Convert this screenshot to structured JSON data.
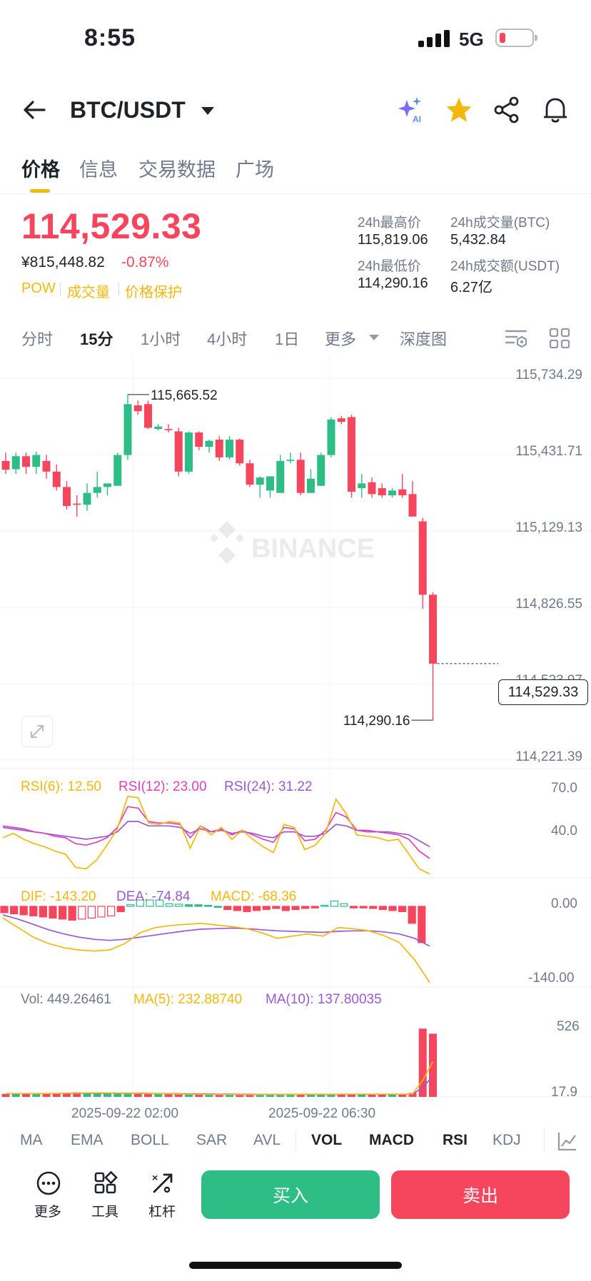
{
  "status_bar": {
    "time": "8:55",
    "network": "5G"
  },
  "header": {
    "pair": "BTC/USDT",
    "icons": [
      "back-arrow-icon",
      "dropdown-caret-icon",
      "ai-sparkle-icon",
      "star-icon",
      "share-icon",
      "bell-icon"
    ]
  },
  "tabs": [
    {
      "label": "价格",
      "active": true
    },
    {
      "label": "信息"
    },
    {
      "label": "交易数据"
    },
    {
      "label": "广场"
    }
  ],
  "ticker": {
    "last_price": "114,529.33",
    "cny_price": "¥815,448.82",
    "change_pct": "-0.87%",
    "tags": [
      "POW",
      "成交量",
      "价格保护"
    ],
    "stats": {
      "high_label": "24h最高价",
      "high": "115,819.06",
      "vol_btc_label": "24h成交量(BTC)",
      "vol_btc": "5,432.84",
      "low_label": "24h最低价",
      "low": "114,290.16",
      "vol_usdt_label": "24h成交额(USDT)",
      "vol_usdt": "6.27亿"
    }
  },
  "timeframes": [
    {
      "label": "分时"
    },
    {
      "label": "15分",
      "active": true
    },
    {
      "label": "1小时"
    },
    {
      "label": "4小时"
    },
    {
      "label": "1日"
    },
    {
      "label": "更多"
    },
    {
      "label": "深度图"
    }
  ],
  "chart": {
    "watermark": "BINANCE",
    "price_axis": [
      "115,734.29",
      "115,431.71",
      "115,129.13",
      "114,826.55",
      "114,523.97",
      "114,221.39"
    ],
    "current_price_tag": "114,529.33",
    "high_marker": "115,665.52",
    "low_marker": "114,290.16",
    "time_axis": [
      "2025-09-22 02:00",
      "2025-09-22 06:30"
    ]
  },
  "rsi": {
    "rsi6": "RSI(6): 12.50",
    "rsi12": "RSI(12): 23.00",
    "rsi24": "RSI(24): 31.22",
    "axis_top": "70.0",
    "axis_mid": "40.0"
  },
  "macd": {
    "dif": "DIF: -143.20",
    "dea": "DEA: -74.84",
    "macd": "MACD: -68.36",
    "axis_top": "0.00",
    "axis_bottom": "-140.00"
  },
  "volume": {
    "vol": "Vol: 449.26461",
    "ma5": "MA(5): 232.88740",
    "ma10": "MA(10): 137.80035",
    "axis_top": "526",
    "axis_bottom": "17.9"
  },
  "indicator_tabs": [
    {
      "label": "MA"
    },
    {
      "label": "EMA"
    },
    {
      "label": "BOLL"
    },
    {
      "label": "SAR"
    },
    {
      "label": "AVL"
    },
    {
      "label": "VOL",
      "active": true
    },
    {
      "label": "MACD",
      "active": true
    },
    {
      "label": "RSI",
      "active": true
    },
    {
      "label": "KDJ"
    }
  ],
  "toolbar": {
    "more": "更多",
    "tools": "工具",
    "leverage": "杠杆",
    "buy": "买入",
    "sell": "卖出"
  },
  "colors": {
    "up": "#2ebd85",
    "down": "#f6465d",
    "accent": "#f0b90b",
    "purple": "#9b59d0",
    "pink": "#e040c0"
  },
  "chart_data": {
    "type": "candlestick",
    "interval": "15分",
    "candles": [
      {
        "o": 115385,
        "h": 115420,
        "l": 115330,
        "c": 115348
      },
      {
        "o": 115350,
        "h": 115420,
        "l": 115330,
        "c": 115405
      },
      {
        "o": 115405,
        "h": 115420,
        "l": 115330,
        "c": 115360
      },
      {
        "o": 115360,
        "h": 115425,
        "l": 115330,
        "c": 115410
      },
      {
        "o": 115385,
        "h": 115410,
        "l": 115310,
        "c": 115340
      },
      {
        "o": 115340,
        "h": 115370,
        "l": 115260,
        "c": 115275
      },
      {
        "o": 115275,
        "h": 115300,
        "l": 115180,
        "c": 115195
      },
      {
        "o": 115205,
        "h": 115240,
        "l": 115150,
        "c": 115200
      },
      {
        "o": 115200,
        "h": 115290,
        "l": 115175,
        "c": 115250
      },
      {
        "o": 115250,
        "h": 115340,
        "l": 115230,
        "c": 115275
      },
      {
        "o": 115275,
        "h": 115290,
        "l": 115240,
        "c": 115290
      },
      {
        "o": 115280,
        "h": 115420,
        "l": 115280,
        "c": 115410
      },
      {
        "o": 115410,
        "h": 115665,
        "l": 115390,
        "c": 115625
      },
      {
        "o": 115620,
        "h": 115640,
        "l": 115580,
        "c": 115595
      },
      {
        "o": 115625,
        "h": 115640,
        "l": 115520,
        "c": 115525
      },
      {
        "o": 115520,
        "h": 115540,
        "l": 115515,
        "c": 115530
      },
      {
        "o": 115520,
        "h": 115540,
        "l": 115505,
        "c": 115515
      },
      {
        "o": 115510,
        "h": 115525,
        "l": 115320,
        "c": 115340
      },
      {
        "o": 115340,
        "h": 115510,
        "l": 115330,
        "c": 115505
      },
      {
        "o": 115505,
        "h": 115510,
        "l": 115430,
        "c": 115445
      },
      {
        "o": 115445,
        "h": 115475,
        "l": 115420,
        "c": 115470
      },
      {
        "o": 115475,
        "h": 115490,
        "l": 115385,
        "c": 115400
      },
      {
        "o": 115400,
        "h": 115490,
        "l": 115390,
        "c": 115475
      },
      {
        "o": 115475,
        "h": 115480,
        "l": 115365,
        "c": 115375
      },
      {
        "o": 115375,
        "h": 115390,
        "l": 115275,
        "c": 115285
      },
      {
        "o": 115285,
        "h": 115320,
        "l": 115230,
        "c": 115315
      },
      {
        "o": 115260,
        "h": 115320,
        "l": 115230,
        "c": 115320
      },
      {
        "o": 115250,
        "h": 115410,
        "l": 115250,
        "c": 115385
      },
      {
        "o": 115385,
        "h": 115420,
        "l": 115375,
        "c": 115390
      },
      {
        "o": 115390,
        "h": 115420,
        "l": 115240,
        "c": 115250
      },
      {
        "o": 115250,
        "h": 115350,
        "l": 115250,
        "c": 115310
      },
      {
        "o": 115280,
        "h": 115420,
        "l": 115280,
        "c": 115410
      },
      {
        "o": 115410,
        "h": 115570,
        "l": 115400,
        "c": 115560
      },
      {
        "o": 115565,
        "h": 115575,
        "l": 115540,
        "c": 115550
      },
      {
        "o": 115570,
        "h": 115580,
        "l": 115230,
        "c": 115255
      },
      {
        "o": 115270,
        "h": 115330,
        "l": 115230,
        "c": 115290
      },
      {
        "o": 115295,
        "h": 115315,
        "l": 115230,
        "c": 115245
      },
      {
        "o": 115270,
        "h": 115290,
        "l": 115230,
        "c": 115240
      },
      {
        "o": 115240,
        "h": 115270,
        "l": 115230,
        "c": 115260
      },
      {
        "o": 115265,
        "h": 115330,
        "l": 115230,
        "c": 115240
      },
      {
        "o": 115245,
        "h": 115300,
        "l": 115205,
        "c": 115150
      },
      {
        "o": 115130,
        "h": 115145,
        "l": 114760,
        "c": 114820
      },
      {
        "o": 114820,
        "h": 114830,
        "l": 114290,
        "c": 114529
      }
    ],
    "rsi": {
      "rsi6": [
        37,
        40,
        36,
        33,
        31,
        28,
        26,
        17,
        16,
        22,
        32,
        43,
        65,
        64,
        47,
        46,
        48,
        47,
        30,
        45,
        39,
        44,
        36,
        42,
        36,
        31,
        27,
        46,
        44,
        29,
        32,
        40,
        63,
        53,
        39,
        38,
        37,
        35,
        36,
        26,
        16,
        12.5
      ],
      "rsi12": [
        45,
        44,
        43,
        41,
        40,
        38,
        37,
        33,
        32,
        34,
        37,
        44,
        58,
        57,
        48,
        47,
        47,
        46,
        37,
        45,
        41,
        43,
        39,
        42,
        39,
        36,
        34,
        44,
        43,
        35,
        36,
        42,
        54,
        51,
        42,
        41,
        41,
        40,
        39,
        36,
        28,
        23
      ],
      "rsi24": [
        44,
        43,
        42,
        41,
        40,
        39,
        38,
        37,
        36,
        37,
        38,
        41,
        48,
        48,
        45,
        45,
        45,
        44,
        40,
        43,
        41,
        42,
        40,
        41,
        40,
        38,
        37,
        41,
        41,
        38,
        38,
        40,
        46,
        45,
        42,
        42,
        41,
        41,
        40,
        39,
        35,
        31
      ]
    },
    "macd": {
      "dif": [
        -22,
        -40,
        -58,
        -70,
        -78,
        -82,
        -84,
        -82,
        -70,
        -50,
        -40,
        -36,
        -34,
        -32,
        -35,
        -38,
        -42,
        -50,
        -60,
        -56,
        -52,
        -56,
        -40,
        -42,
        -46,
        -55,
        -68,
        -100,
        -143.2
      ],
      "dea": [
        -16,
        -24,
        -34,
        -44,
        -52,
        -58,
        -62,
        -64,
        -62,
        -58,
        -54,
        -50,
        -46,
        -43,
        -42,
        -41,
        -42,
        -44,
        -46,
        -47,
        -48,
        -49,
        -47,
        -46,
        -46,
        -48,
        -52,
        -60,
        -74.84
      ],
      "hist": [
        -12,
        -14,
        -16,
        -18,
        -20,
        -22,
        -24,
        -26,
        -24,
        -22,
        -20,
        -18,
        -10,
        3,
        12,
        12,
        12,
        5,
        4,
        3,
        3,
        2,
        0,
        -6,
        -8,
        -10,
        -8,
        -6,
        -4,
        -8,
        -6,
        -4,
        -3,
        2,
        10,
        5,
        -3,
        -3,
        -4,
        -6,
        -8,
        -10,
        -32,
        -68.36
      ]
    },
    "volume": {
      "values": [
        20,
        22,
        24,
        18,
        22,
        25,
        26,
        30,
        28,
        27,
        24,
        22,
        25,
        24,
        22,
        20,
        18,
        18,
        16,
        17,
        15,
        14,
        15,
        16,
        14,
        15,
        16,
        18,
        15,
        17,
        16,
        18,
        20,
        17,
        18,
        19,
        17,
        18,
        20,
        16,
        26,
        449.26,
        416
      ],
      "ma5": [
        22,
        22,
        22,
        21,
        22,
        23,
        24,
        25,
        26,
        27,
        26,
        25,
        24,
        23,
        22,
        21,
        20,
        19,
        18,
        17,
        16,
        16,
        15,
        15,
        15,
        15,
        16,
        16,
        16,
        17,
        17,
        17,
        17,
        18,
        18,
        18,
        18,
        18,
        18,
        18,
        19,
        109,
        232.89
      ],
      "ma10": [
        22,
        22,
        22,
        22,
        22,
        22,
        23,
        24,
        24,
        24,
        24,
        24,
        24,
        24,
        23,
        22,
        21,
        21,
        20,
        20,
        19,
        18,
        18,
        17,
        17,
        16,
        16,
        16,
        16,
        16,
        16,
        16,
        16,
        17,
        17,
        17,
        17,
        17,
        17,
        17,
        18,
        62,
        137.8
      ]
    }
  }
}
